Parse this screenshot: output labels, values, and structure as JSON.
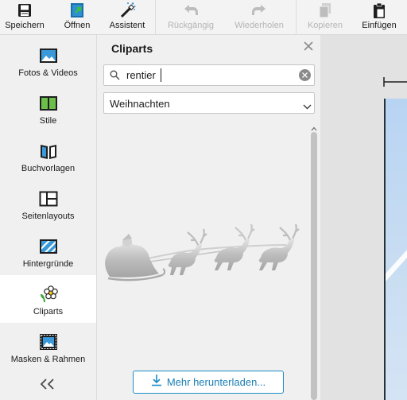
{
  "toolbar": {
    "buttons": [
      {
        "label": "Speichern",
        "icon": "save-icon",
        "enabled": true
      },
      {
        "label": "Öffnen",
        "icon": "open-icon",
        "enabled": true
      },
      {
        "label": "Assistent",
        "icon": "wand-icon",
        "enabled": true
      },
      {
        "label": "Rückgängig",
        "icon": "undo-icon",
        "enabled": false
      },
      {
        "label": "Wiederholen",
        "icon": "redo-icon",
        "enabled": false
      },
      {
        "label": "Kopieren",
        "icon": "copy-icon",
        "enabled": false
      },
      {
        "label": "Einfügen",
        "icon": "paste-icon",
        "enabled": true
      }
    ]
  },
  "sidebar": {
    "items": [
      {
        "label": "Fotos & Videos",
        "icon": "photos-icon",
        "active": false
      },
      {
        "label": "Stile",
        "icon": "styles-icon",
        "active": false
      },
      {
        "label": "Buchvorlagen",
        "icon": "book-templates-icon",
        "active": false
      },
      {
        "label": "Seitenlayouts",
        "icon": "page-layouts-icon",
        "active": false
      },
      {
        "label": "Hintergründe",
        "icon": "backgrounds-icon",
        "active": false
      },
      {
        "label": "Cliparts",
        "icon": "flower-icon",
        "active": true
      },
      {
        "label": "Masken & Rahmen",
        "icon": "masks-frames-icon",
        "active": false
      }
    ],
    "collapse_icon": "double-chevron-left-icon"
  },
  "panel": {
    "title": "Cliparts",
    "search": {
      "value": "rentier"
    },
    "category": {
      "selected": "Weihnachten"
    },
    "results": [
      {
        "name": "santa-sleigh-reindeer-clipart"
      }
    ],
    "more_button": {
      "label": "Mehr herunterladen..."
    }
  },
  "colors": {
    "accent": "#1a8fc6",
    "active_nav_bg": "#ffffff",
    "panel_bg": "#f0f0f0",
    "canvas_bg": "#e2e2e2",
    "page_sky": "#b8d4f3"
  }
}
